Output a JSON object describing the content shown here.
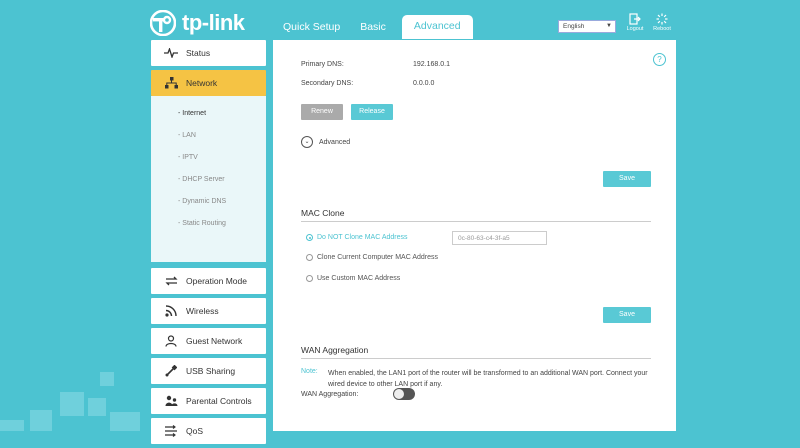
{
  "brand": {
    "name": "tp-link"
  },
  "header": {
    "tabs": [
      {
        "label": "Quick Setup",
        "active": false
      },
      {
        "label": "Basic",
        "active": false
      },
      {
        "label": "Advanced",
        "active": true
      }
    ],
    "language": "English",
    "logout_label": "Logout",
    "reboot_label": "Reboot"
  },
  "sidebar": {
    "items": [
      {
        "label": "Status",
        "icon": "pulse-icon"
      },
      {
        "label": "Network",
        "icon": "network-icon",
        "active": true
      },
      {
        "label": "Operation Mode",
        "icon": "operation-mode-icon"
      },
      {
        "label": "Wireless",
        "icon": "wireless-icon"
      },
      {
        "label": "Guest Network",
        "icon": "guest-network-icon"
      },
      {
        "label": "USB Sharing",
        "icon": "usb-icon"
      },
      {
        "label": "Parental Controls",
        "icon": "parental-controls-icon"
      },
      {
        "label": "QoS",
        "icon": "qos-icon"
      }
    ],
    "subitems": [
      {
        "label": "- Internet",
        "current": true
      },
      {
        "label": "- LAN"
      },
      {
        "label": "- IPTV"
      },
      {
        "label": "- DHCP Server"
      },
      {
        "label": "- Dynamic DNS"
      },
      {
        "label": "- Static Routing"
      }
    ]
  },
  "internet": {
    "primary_dns_label": "Primary DNS:",
    "primary_dns_value": "192.168.0.1",
    "secondary_dns_label": "Secondary DNS:",
    "secondary_dns_value": "0.0.0.0",
    "renew_label": "Renew",
    "release_label": "Release",
    "advanced_label": "Advanced",
    "save_label": "Save"
  },
  "mac_clone": {
    "title": "MAC Clone",
    "options": [
      {
        "label": "Do NOT Clone MAC Address",
        "selected": true
      },
      {
        "label": "Clone Current Computer MAC Address",
        "selected": false
      },
      {
        "label": "Use Custom MAC Address",
        "selected": false
      }
    ],
    "mac_value": "0c-80-63-c4-3f-a5",
    "save_label": "Save"
  },
  "wan_aggregation": {
    "title": "WAN Aggregation",
    "note_label": "Note:",
    "note_text": "When enabled, the LAN1 port of the router will be transformed to an additional WAN port. Connect your wired device to other LAN port if any.",
    "field_label": "WAN Aggregation:",
    "enabled": false
  },
  "colors": {
    "accent": "#4cc3d1",
    "active_nav": "#f5c344",
    "background": "#4cc3d1"
  }
}
